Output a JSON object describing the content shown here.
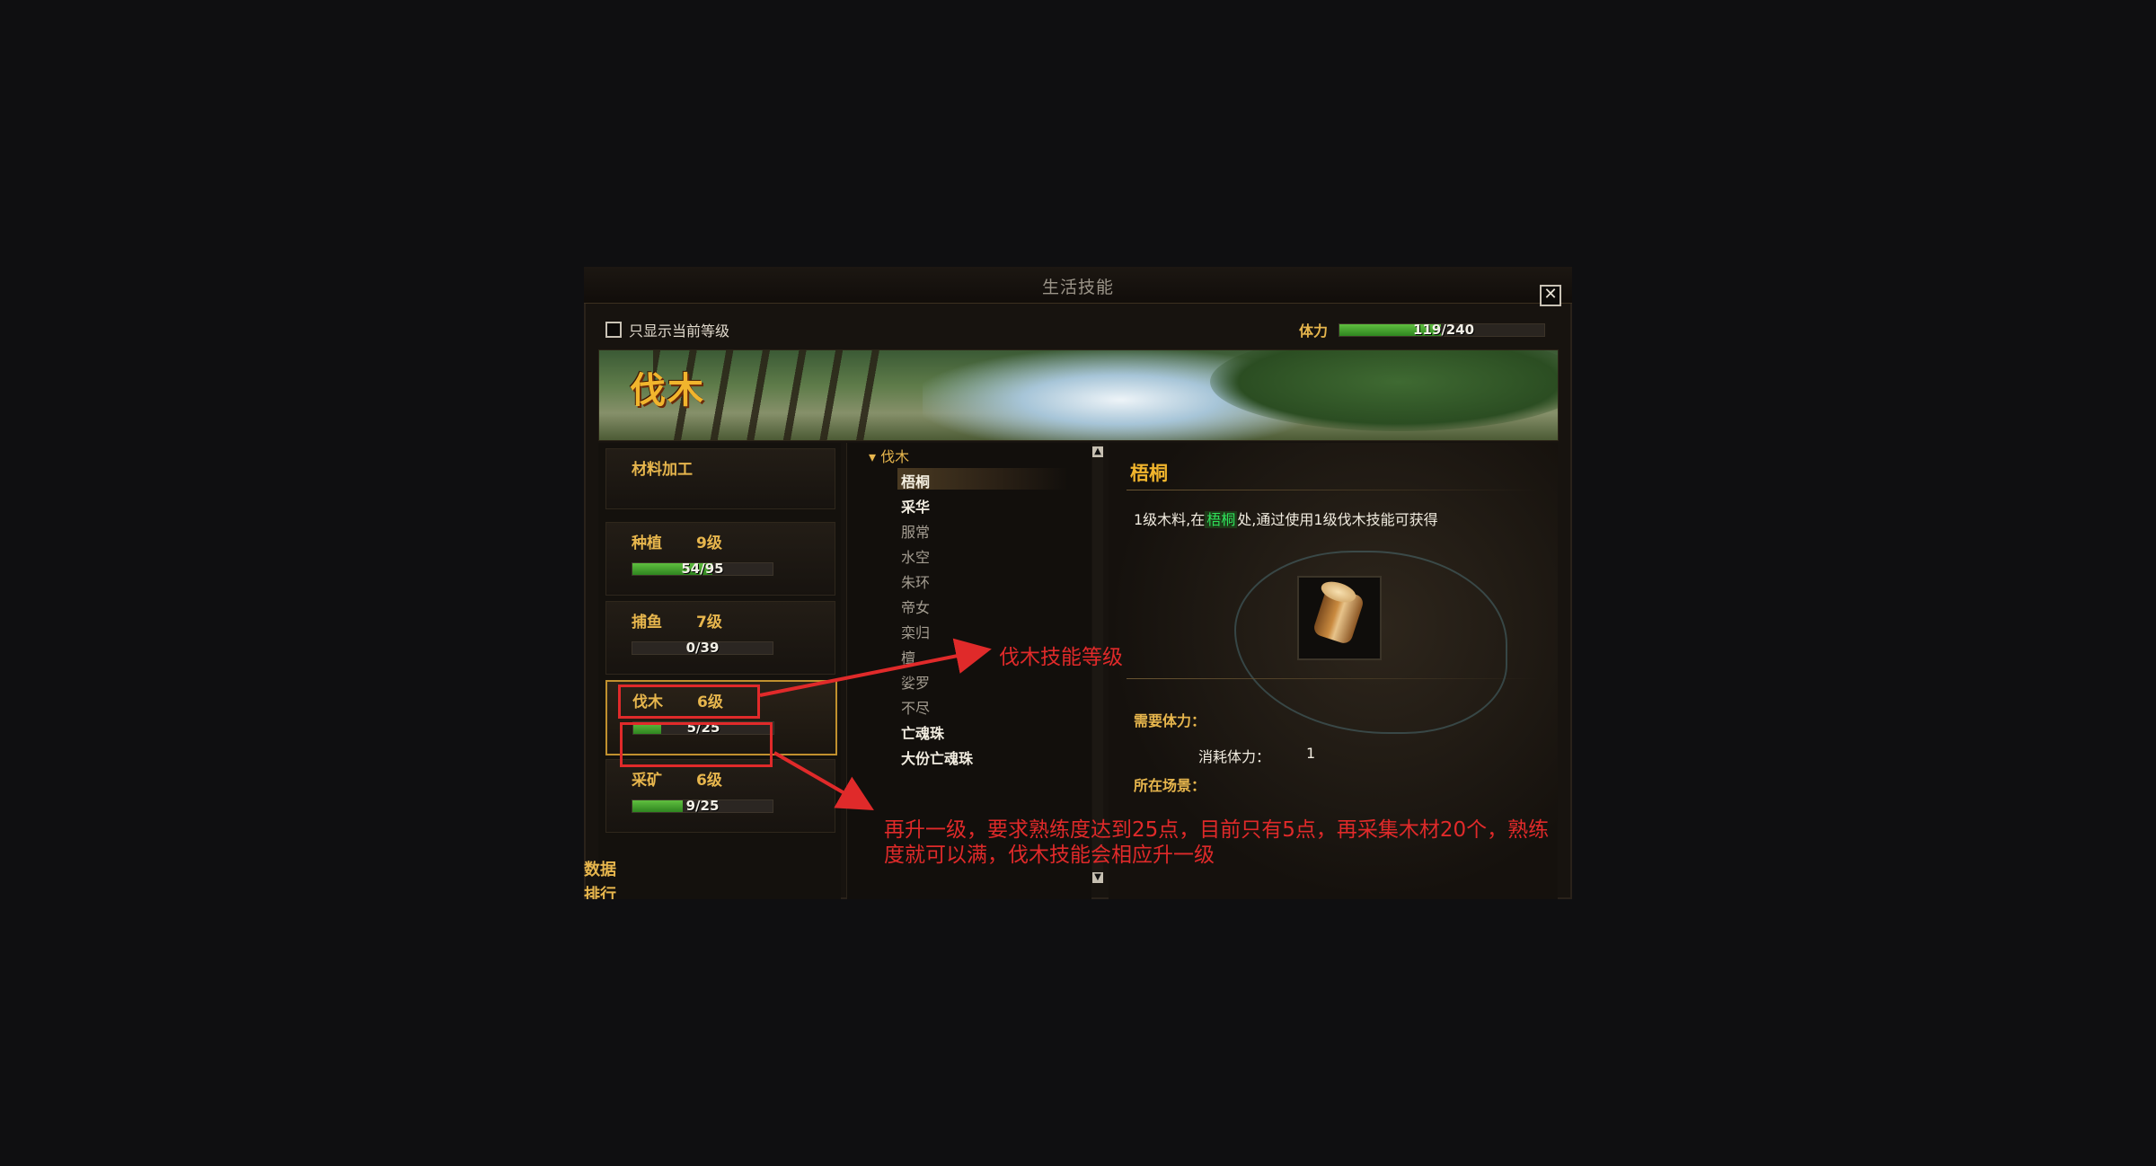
{
  "window": {
    "title": "生活技能",
    "close_label": "✕"
  },
  "filter": {
    "label": "只显示当前等级"
  },
  "stamina": {
    "label": "体力",
    "value": "119/240",
    "current": 119,
    "max": 240
  },
  "banner": {
    "title": "伐木"
  },
  "skills": [
    {
      "name": "材料加工",
      "level": "",
      "progress": ""
    },
    {
      "name": "种植",
      "level": "9级",
      "progress": "54/95",
      "cur": 54,
      "max": 95
    },
    {
      "name": "捕鱼",
      "level": "7级",
      "progress": "0/39",
      "cur": 0,
      "max": 39
    },
    {
      "name": "伐木",
      "level": "6级",
      "progress": "5/25",
      "cur": 5,
      "max": 25
    },
    {
      "name": "采矿",
      "level": "6级",
      "progress": "9/25",
      "cur": 9,
      "max": 25
    }
  ],
  "left_clip": {
    "line1": "数据",
    "line2": "排行"
  },
  "list": {
    "category": "▾ 伐木",
    "items": [
      "梧桐",
      "采华",
      "服常",
      "水空",
      "朱环",
      "帝女",
      "栾归",
      "檀",
      "娑罗",
      "不尽",
      "亡魂珠",
      "大份亡魂珠"
    ]
  },
  "detail": {
    "title": "梧桐",
    "desc_pre": "1级木料,在",
    "desc_hl": "梧桐",
    "desc_post": "处,通过使用1级伐木技能可获得",
    "req_label": "需要体力：",
    "cost_label": "消耗体力：",
    "cost_value": "1",
    "scene_label": "所在场景："
  },
  "annotations": {
    "note1": "伐木技能等级",
    "note2_line1": "再升一级，要求熟练度达到25点，目前只有5点，再采集木材20个，熟练",
    "note2_line2": "度就可以满，伐木技能会相应升一级",
    "color": "#e02a2a"
  },
  "colors": {
    "accent": "#e7b64d",
    "bar": "#3fa52a"
  }
}
